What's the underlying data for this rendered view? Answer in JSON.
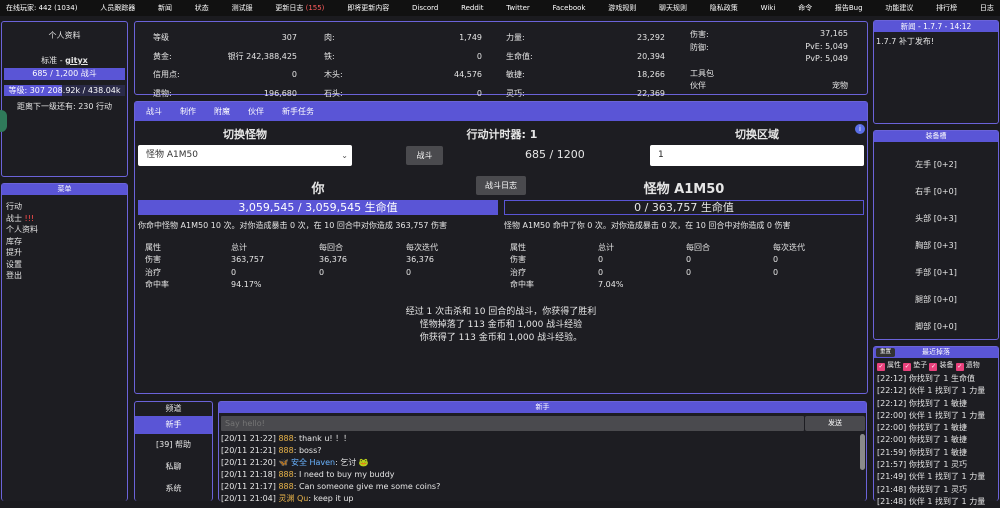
{
  "nav": {
    "online": "在线玩家: 442 (1034)",
    "items": [
      "人员跟踪器",
      "新闻",
      "状态",
      "测试服",
      "更新日志",
      "即将更新内容",
      "Discord",
      "Reddit",
      "Twitter",
      "Facebook",
      "游戏规则",
      "聊天规则",
      "隐私政策",
      "Wiki",
      "命令",
      "报告Bug",
      "功能建议",
      "排行榜",
      "日志"
    ],
    "changelog_count": "(155)"
  },
  "profile": {
    "title": "个人资料",
    "rank_label": "标准 - ",
    "username": "gityx",
    "action_bar": "685 / 1,200 战斗",
    "level_bar": "等级: 307 208.92k / 438.04k",
    "next_level": "距离下一级还有: 230 行动"
  },
  "menu": {
    "title": "菜单",
    "items": [
      "行动",
      "战士",
      "个人资料",
      "库存",
      "提升",
      "设置",
      "登出"
    ],
    "warrior_badge": "!!!"
  },
  "stats": {
    "col1": [
      [
        "等级",
        "307"
      ],
      [
        "黄金:",
        "银行 242,388,425"
      ],
      [
        "信用点:",
        "0"
      ],
      [
        "遗物:",
        "196,680"
      ]
    ],
    "col2": [
      [
        "肉:",
        "1,749"
      ],
      [
        "铁:",
        "0"
      ],
      [
        "木头:",
        "44,576"
      ],
      [
        "石头:",
        "0"
      ]
    ],
    "col3": [
      [
        "力量:",
        "23,292"
      ],
      [
        "生命值:",
        "20,394"
      ],
      [
        "敏捷:",
        "18,266"
      ],
      [
        "灵巧:",
        "22,369"
      ]
    ],
    "col4": {
      "damage_label": "伤害:",
      "damage": "37,165",
      "defense_label": "防御:",
      "pve": "PvE: 5,049",
      "pvp": "PvP: 5,049",
      "toolkit": "工具包",
      "partner": "伙伴",
      "pet": "宠物"
    }
  },
  "tabs": [
    "战斗",
    "制作",
    "附魔",
    "伙伴",
    "新手任务"
  ],
  "battle": {
    "switch_monster": "切换怪物",
    "action_timer": "行动计时器: 1",
    "switch_zone": "切换区域",
    "monster_select": "怪物 A1M50",
    "fight_btn": "战斗",
    "action_count": "685 / 1200",
    "zone_value": "1",
    "log_btn": "战斗日志",
    "you": "你",
    "monster_name": "怪物 A1M50",
    "you_hp": "3,059,545 / 3,059,545 生命值",
    "monster_hp": "0 / 363,757 生命值",
    "you_summary": "你命中怪物 A1M50 10 次。对你造成暴击 0 次，在 10 回合中对你造成 363,757 伤害",
    "monster_summary": "怪物 A1M50 命中了你 0 次。对你造成暴击 0 次，在 10 回合中对你造成 0 伤害",
    "headers": [
      "属性",
      "总计",
      "每回合",
      "每次迭代"
    ],
    "you_rows": [
      [
        "伤害",
        "363,757",
        "36,376",
        "36,376"
      ],
      [
        "治疗",
        "0",
        "0",
        "0"
      ],
      [
        "命中率",
        "94.17%",
        "",
        ""
      ]
    ],
    "monster_rows": [
      [
        "伤害",
        "0",
        "0",
        "0"
      ],
      [
        "治疗",
        "0",
        "0",
        "0"
      ],
      [
        "命中率",
        "7.04%",
        "",
        ""
      ]
    ],
    "result": [
      "经过 1 次击杀和 10 回合的战斗，你获得了胜利",
      "怪物掉落了 113 金币和 1,000 战斗经验",
      "你获得了 113 金币和 1,000 战斗经验。"
    ]
  },
  "news": {
    "title": "新闻 - 1.7.7 - 14:12",
    "text": "1.7.7 补丁发布!"
  },
  "equipment": {
    "title": "装备槽",
    "slots": [
      "左手 [0+2]",
      "右手 [0+0]",
      "头部 [0+3]",
      "胸部 [0+3]",
      "手部 [0+1]",
      "腿部 [0+0]",
      "脚部 [0+0]"
    ]
  },
  "drops": {
    "reset": "重置",
    "title": "最近掉落",
    "filters": [
      "属性",
      "垫子",
      "装备",
      "遗物"
    ],
    "items": [
      "[22:12] 你找到了 1 生命值",
      "[22:12] 伙伴 1 找到了 1 力量",
      "[22:12] 你找到了 1 敏捷",
      "[22:00] 伙伴 1 找到了 1 力量",
      "[22:00] 你找到了 1 敏捷",
      "[22:00] 你找到了 1 敏捷",
      "[21:59] 你找到了 1 敏捷",
      "[21:57] 你找到了 1 灵巧",
      "[21:49] 伙伴 1 找到了 1 力量",
      "[21:48] 你找到了 1 灵巧",
      "[21:48] 伙伴 1 找到了 1 力量"
    ]
  },
  "channels": {
    "title": "频道",
    "items": [
      "新手",
      "[39] 帮助",
      "私聊",
      "系统"
    ]
  },
  "chat": {
    "title": "新手",
    "placeholder": "Say hello!",
    "send": "发送",
    "lines": [
      {
        "t": "[20/11 21:22] ",
        "u": "888",
        "m": ": thank u! ！！"
      },
      {
        "t": "[20/11 21:21] ",
        "u": "888",
        "m": ": boss?"
      },
      {
        "t": "[20/11 21:20] ",
        "u": "🦋 安全 Haven",
        "m": ": 乞讨 🐸"
      },
      {
        "t": "[20/11 21:18] ",
        "u": "888",
        "m": ": I need to buy my buddy"
      },
      {
        "t": "[20/11 21:17] ",
        "u": "888",
        "m": ": Can someone give me some coins?"
      },
      {
        "t": "[20/11 21:04] ",
        "u": "灵渊 Qu",
        "m": ": keep it up"
      }
    ]
  }
}
